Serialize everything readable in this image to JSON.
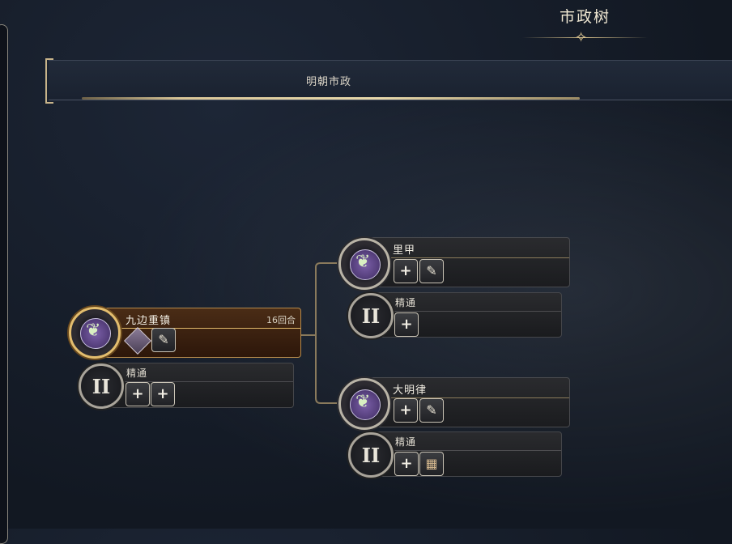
{
  "screen": {
    "title": "市政树",
    "header": {
      "label": "明朝市政"
    }
  },
  "nodes": [
    {
      "id": "jiubian",
      "name": "九边重镇",
      "turns": "16回合",
      "mastery_label": "精通",
      "mastery_tier": "II"
    },
    {
      "id": "lijia",
      "name": "里甲",
      "mastery_label": "精通",
      "mastery_tier": "II"
    },
    {
      "id": "daminglv",
      "name": "大明律",
      "mastery_label": "精通",
      "mastery_tier": "II"
    }
  ],
  "icons": {
    "plus": "+",
    "quill": "🪶",
    "building": "▦",
    "title_ornament": "✧"
  },
  "colors": {
    "accent_gold": "#e3bd6e",
    "active_panel": "#4a2c16",
    "panel": "#2a2b2e"
  }
}
